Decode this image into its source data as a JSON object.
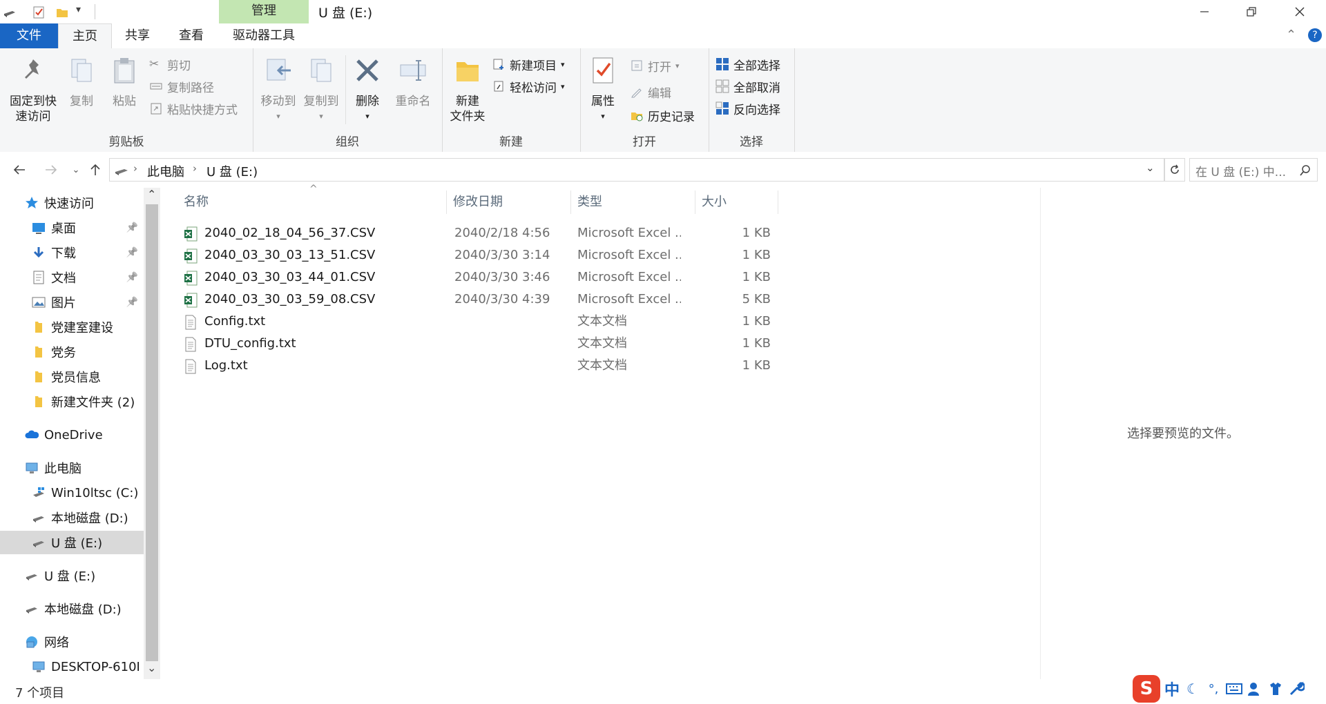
{
  "window": {
    "title": "U 盘 (E:)",
    "context_tab": "管理"
  },
  "ribbon_tabs": [
    "文件",
    "主页",
    "共享",
    "查看",
    "驱动器工具"
  ],
  "ribbon": {
    "clipboard": {
      "label": "剪贴板",
      "pin_quick": "固定到快速访问",
      "pin_quick_l1": "固定到快",
      "pin_quick_l2": "速访问",
      "copy": "复制",
      "paste": "粘贴",
      "cut": "剪切",
      "copy_path": "复制路径",
      "paste_shortcut": "粘贴快捷方式"
    },
    "organize": {
      "label": "组织",
      "move_to": "移动到",
      "copy_to": "复制到",
      "delete": "删除",
      "rename": "重命名"
    },
    "new": {
      "label": "新建",
      "new_folder_l1": "新建",
      "new_folder_l2": "文件夹",
      "new_item": "新建项目",
      "easy_access": "轻松访问"
    },
    "open": {
      "label": "打开",
      "properties": "属性",
      "open": "打开",
      "edit": "编辑",
      "history": "历史记录"
    },
    "select": {
      "label": "选择",
      "select_all": "全部选择",
      "select_none": "全部取消",
      "invert": "反向选择"
    }
  },
  "address": {
    "crumbs": [
      "此电脑",
      "U 盘 (E:)"
    ],
    "search_placeholder": "在 U 盘 (E:) 中..."
  },
  "nav": [
    {
      "label": "快速访问",
      "icon": "star-icon",
      "level": 0
    },
    {
      "label": "桌面",
      "icon": "desktop-icon",
      "level": 1,
      "pinned": true
    },
    {
      "label": "下载",
      "icon": "download-icon",
      "level": 1,
      "pinned": true
    },
    {
      "label": "文档",
      "icon": "document-icon",
      "level": 1,
      "pinned": true
    },
    {
      "label": "图片",
      "icon": "picture-icon",
      "level": 1,
      "pinned": true
    },
    {
      "label": "党建室建设",
      "icon": "folder-icon",
      "level": 1
    },
    {
      "label": "党务",
      "icon": "folder-icon",
      "level": 1
    },
    {
      "label": "党员信息",
      "icon": "folder-icon",
      "level": 1
    },
    {
      "label": "新建文件夹 (2)",
      "icon": "folder-icon",
      "level": 1
    },
    {
      "label": "OneDrive",
      "icon": "cloud-icon",
      "level": 0
    },
    {
      "label": "此电脑",
      "icon": "computer-icon",
      "level": 0
    },
    {
      "label": "Win10ltsc (C:)",
      "icon": "windows-drive-icon",
      "level": 1
    },
    {
      "label": "本地磁盘 (D:)",
      "icon": "drive-icon",
      "level": 1
    },
    {
      "label": "U 盘 (E:)",
      "icon": "drive-icon",
      "level": 1,
      "selected": true
    },
    {
      "label": "U 盘 (E:)",
      "icon": "drive-icon",
      "level": 0
    },
    {
      "label": "本地磁盘 (D:)",
      "icon": "drive-icon",
      "level": 0
    },
    {
      "label": "网络",
      "icon": "network-icon",
      "level": 0
    },
    {
      "label": "DESKTOP-610I",
      "icon": "computer-icon",
      "level": 1
    }
  ],
  "columns": {
    "name": "名称",
    "date": "修改日期",
    "type": "类型",
    "size": "大小"
  },
  "files": [
    {
      "name": "2040_02_18_04_56_37.CSV",
      "date": "2040/2/18 4:56",
      "type": "Microsoft Excel ...",
      "size": "1 KB",
      "icon": "excel-file-icon"
    },
    {
      "name": "2040_03_30_03_13_51.CSV",
      "date": "2040/3/30 3:14",
      "type": "Microsoft Excel ...",
      "size": "1 KB",
      "icon": "excel-file-icon"
    },
    {
      "name": "2040_03_30_03_44_01.CSV",
      "date": "2040/3/30 3:46",
      "type": "Microsoft Excel ...",
      "size": "1 KB",
      "icon": "excel-file-icon"
    },
    {
      "name": "2040_03_30_03_59_08.CSV",
      "date": "2040/3/30 4:39",
      "type": "Microsoft Excel ...",
      "size": "5 KB",
      "icon": "excel-file-icon"
    },
    {
      "name": "Config.txt",
      "date": "",
      "type": "文本文档",
      "size": "1 KB",
      "icon": "text-file-icon"
    },
    {
      "name": "DTU_config.txt",
      "date": "",
      "type": "文本文档",
      "size": "1 KB",
      "icon": "text-file-icon"
    },
    {
      "name": "Log.txt",
      "date": "",
      "type": "文本文档",
      "size": "1 KB",
      "icon": "text-file-icon"
    }
  ],
  "preview_text": "选择要预览的文件。",
  "status": {
    "item_count": "7 个项目"
  },
  "tray": {
    "ime_mode": "中"
  },
  "colors": {
    "file_tab": "#1a66c4",
    "manage_tab": "#c3e6b2",
    "selected_nav": "#d9d9d9",
    "ribbon_bg": "#f5f6f7"
  }
}
